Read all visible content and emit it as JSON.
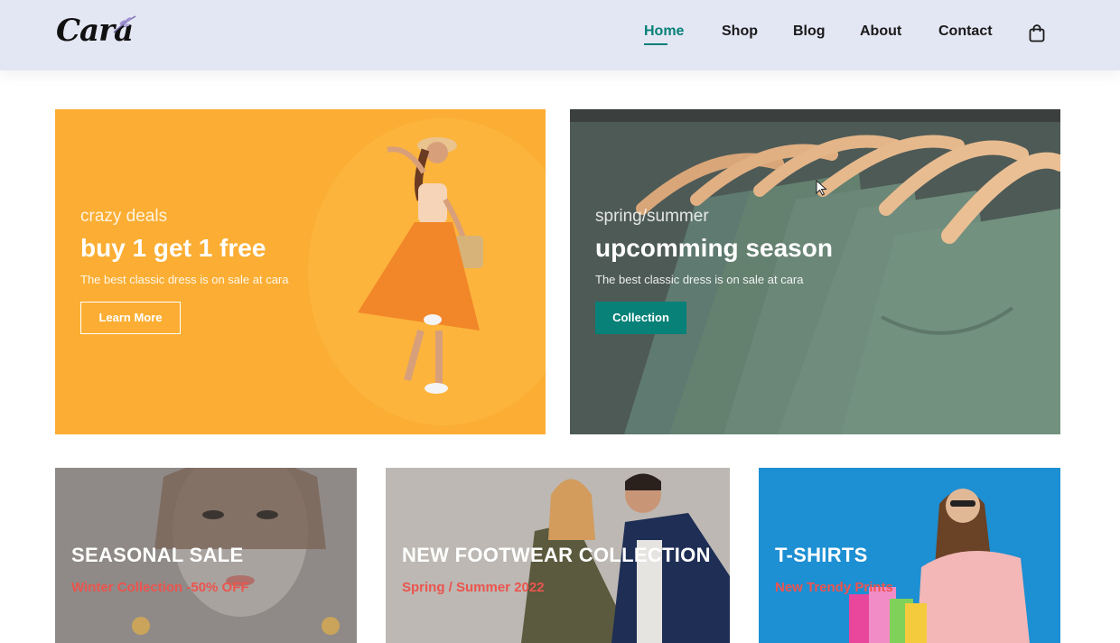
{
  "brand": {
    "logo": "Cara"
  },
  "nav": {
    "items": [
      {
        "label": "Home",
        "active": true
      },
      {
        "label": "Shop",
        "active": false
      },
      {
        "label": "Blog",
        "active": false
      },
      {
        "label": "About",
        "active": false
      },
      {
        "label": "Contact",
        "active": false
      }
    ],
    "cart_icon": "shopping-bag-icon"
  },
  "banners": [
    {
      "pre": "crazy deals",
      "title": "buy 1 get 1 free",
      "desc": "The best classic dress is on sale at cara",
      "button": "Learn More",
      "bg": "#fbae33"
    },
    {
      "pre": "spring/summer",
      "title": "upcomming season",
      "desc": "The best classic dress is on sale at cara",
      "button": "Collection",
      "bg": "#54605b"
    }
  ],
  "small_banners": [
    {
      "title": "SEASONAL SALE",
      "subtitle": "Winter Collection -50% OFF"
    },
    {
      "title": "NEW FOOTWEAR COLLECTION",
      "subtitle": "Spring / Summer 2022"
    },
    {
      "title": "T-SHIRTS",
      "subtitle": "New Trendy Prints"
    }
  ],
  "colors": {
    "accent": "#088178",
    "header_bg": "#e3e6f3",
    "sale_red": "#ec544e"
  }
}
